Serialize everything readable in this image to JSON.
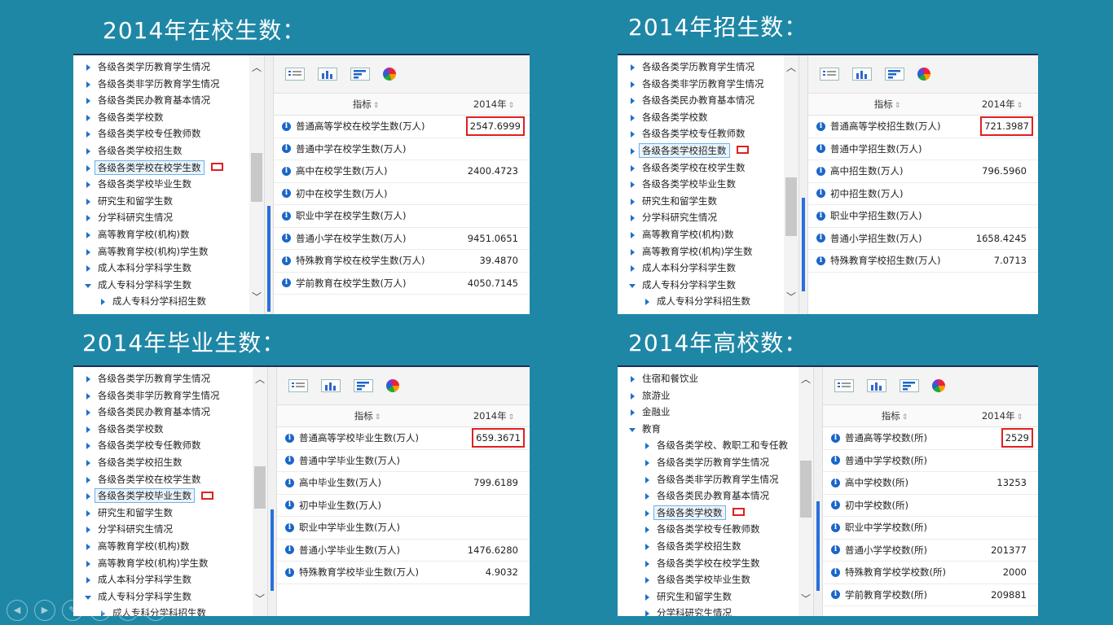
{
  "slides": [
    {
      "title": "2014年在校生数：",
      "tree": [
        {
          "label": "各级各类学历教育学生情况"
        },
        {
          "label": "各级各类非学历教育学生情况"
        },
        {
          "label": "各级各类民办教育基本情况"
        },
        {
          "label": "各级各类学校数"
        },
        {
          "label": "各级各类学校专任教师数"
        },
        {
          "label": "各级各类学校招生数"
        },
        {
          "label": "各级各类学校在校学生数",
          "selected": true
        },
        {
          "label": "各级各类学校毕业生数"
        },
        {
          "label": "研究生和留学生数"
        },
        {
          "label": "分学科研究生情况"
        },
        {
          "label": "高等教育学校(机构)数"
        },
        {
          "label": "高等教育学校(机构)学生数"
        },
        {
          "label": "成人本科分学科学生数"
        },
        {
          "label": "成人专科分学科学生数",
          "open": true
        },
        {
          "label": "成人专科分学科招生数",
          "sub": true
        }
      ],
      "header": {
        "indicator": "指标",
        "year": "2014年"
      },
      "rows": [
        {
          "name": "普通高等学校在校学生数(万人)",
          "value": "2547.6999",
          "highlight": true
        },
        {
          "name": "普通中学在校学生数(万人)",
          "value": ""
        },
        {
          "name": "高中在校学生数(万人)",
          "value": "2400.4723"
        },
        {
          "name": "初中在校学生数(万人)",
          "value": ""
        },
        {
          "name": "职业中学在校学生数(万人)",
          "value": ""
        },
        {
          "name": "普通小学在校学生数(万人)",
          "value": "9451.0651"
        },
        {
          "name": "特殊教育学校在校学生数(万人)",
          "value": "39.4870"
        },
        {
          "name": "学前教育在校学生数(万人)",
          "value": "4050.7145"
        }
      ]
    },
    {
      "title": "2014年招生数：",
      "tree": [
        {
          "label": "各级各类学历教育学生情况"
        },
        {
          "label": "各级各类非学历教育学生情况"
        },
        {
          "label": "各级各类民办教育基本情况"
        },
        {
          "label": "各级各类学校数"
        },
        {
          "label": "各级各类学校专任教师数"
        },
        {
          "label": "各级各类学校招生数",
          "selected": true
        },
        {
          "label": "各级各类学校在校学生数"
        },
        {
          "label": "各级各类学校毕业生数"
        },
        {
          "label": "研究生和留学生数"
        },
        {
          "label": "分学科研究生情况"
        },
        {
          "label": "高等教育学校(机构)数"
        },
        {
          "label": "高等教育学校(机构)学生数"
        },
        {
          "label": "成人本科分学科学生数"
        },
        {
          "label": "成人专科分学科学生数",
          "open": true
        },
        {
          "label": "成人专科分学科招生数",
          "sub": true
        }
      ],
      "header": {
        "indicator": "指标",
        "year": "2014年"
      },
      "rows": [
        {
          "name": "普通高等学校招生数(万人)",
          "value": "721.3987",
          "highlight": true
        },
        {
          "name": "普通中学招生数(万人)",
          "value": ""
        },
        {
          "name": "高中招生数(万人)",
          "value": "796.5960"
        },
        {
          "name": "初中招生数(万人)",
          "value": ""
        },
        {
          "name": "职业中学招生数(万人)",
          "value": ""
        },
        {
          "name": "普通小学招生数(万人)",
          "value": "1658.4245"
        },
        {
          "name": "特殊教育学校招生数(万人)",
          "value": "7.0713"
        }
      ]
    },
    {
      "title": "2014年毕业生数：",
      "tree": [
        {
          "label": "各级各类学历教育学生情况"
        },
        {
          "label": "各级各类非学历教育学生情况"
        },
        {
          "label": "各级各类民办教育基本情况"
        },
        {
          "label": "各级各类学校数"
        },
        {
          "label": "各级各类学校专任教师数"
        },
        {
          "label": "各级各类学校招生数"
        },
        {
          "label": "各级各类学校在校学生数"
        },
        {
          "label": "各级各类学校毕业生数",
          "selected": true
        },
        {
          "label": "研究生和留学生数"
        },
        {
          "label": "分学科研究生情况"
        },
        {
          "label": "高等教育学校(机构)数"
        },
        {
          "label": "高等教育学校(机构)学生数"
        },
        {
          "label": "成人本科分学科学生数"
        },
        {
          "label": "成人专科分学科学生数",
          "open": true
        },
        {
          "label": "成人专科分学科招生数",
          "sub": true
        }
      ],
      "header": {
        "indicator": "指标",
        "year": "2014年"
      },
      "rows": [
        {
          "name": "普通高等学校毕业生数(万人)",
          "value": "659.3671",
          "highlight": true
        },
        {
          "name": "普通中学毕业生数(万人)",
          "value": ""
        },
        {
          "name": "高中毕业生数(万人)",
          "value": "799.6189"
        },
        {
          "name": "初中毕业生数(万人)",
          "value": ""
        },
        {
          "name": "职业中学毕业生数(万人)",
          "value": ""
        },
        {
          "name": "普通小学毕业生数(万人)",
          "value": "1476.6280"
        },
        {
          "name": "特殊教育学校毕业生数(万人)",
          "value": "4.9032"
        }
      ]
    },
    {
      "title": "2014年高校数：",
      "tree": [
        {
          "label": "住宿和餐饮业"
        },
        {
          "label": "旅游业"
        },
        {
          "label": "金融业"
        },
        {
          "label": "教育",
          "open": true
        },
        {
          "label": "各级各类学校、教职工和专任教",
          "sub": true
        },
        {
          "label": "各级各类学历教育学生情况",
          "sub": true
        },
        {
          "label": "各级各类非学历教育学生情况",
          "sub": true
        },
        {
          "label": "各级各类民办教育基本情况",
          "sub": true
        },
        {
          "label": "各级各类学校数",
          "sub": true,
          "selected": true
        },
        {
          "label": "各级各类学校专任教师数",
          "sub": true
        },
        {
          "label": "各级各类学校招生数",
          "sub": true
        },
        {
          "label": "各级各类学校在校学生数",
          "sub": true
        },
        {
          "label": "各级各类学校毕业生数",
          "sub": true
        },
        {
          "label": "研究生和留学生数",
          "sub": true
        },
        {
          "label": "分学科研究生情况",
          "sub": true
        }
      ],
      "header": {
        "indicator": "指标",
        "year": "2014年"
      },
      "rows": [
        {
          "name": "普通高等学校数(所)",
          "value": "2529",
          "highlight": true
        },
        {
          "name": "普通中学学校数(所)",
          "value": ""
        },
        {
          "name": "高中学校数(所)",
          "value": "13253"
        },
        {
          "name": "初中学校数(所)",
          "value": ""
        },
        {
          "name": "职业中学学校数(所)",
          "value": ""
        },
        {
          "name": "普通小学学校数(所)",
          "value": "201377"
        },
        {
          "name": "特殊教育学校学校数(所)",
          "value": "2000"
        },
        {
          "name": "学前教育学校数(所)",
          "value": "209881"
        }
      ]
    }
  ],
  "icons": [
    "list-view-icon",
    "bar-chart-icon",
    "horizontal-bar-icon",
    "pie-chart-icon"
  ],
  "nav_icons": [
    "prev-slide-icon",
    "next-slide-icon",
    "pen-icon",
    "menu-icon",
    "zoom-icon",
    "more-icon"
  ],
  "colors": {
    "background": "#1f87a6",
    "highlight": "#e02020",
    "tree_arrow": "#1a73c9",
    "info_icon": "#1b66c9"
  }
}
